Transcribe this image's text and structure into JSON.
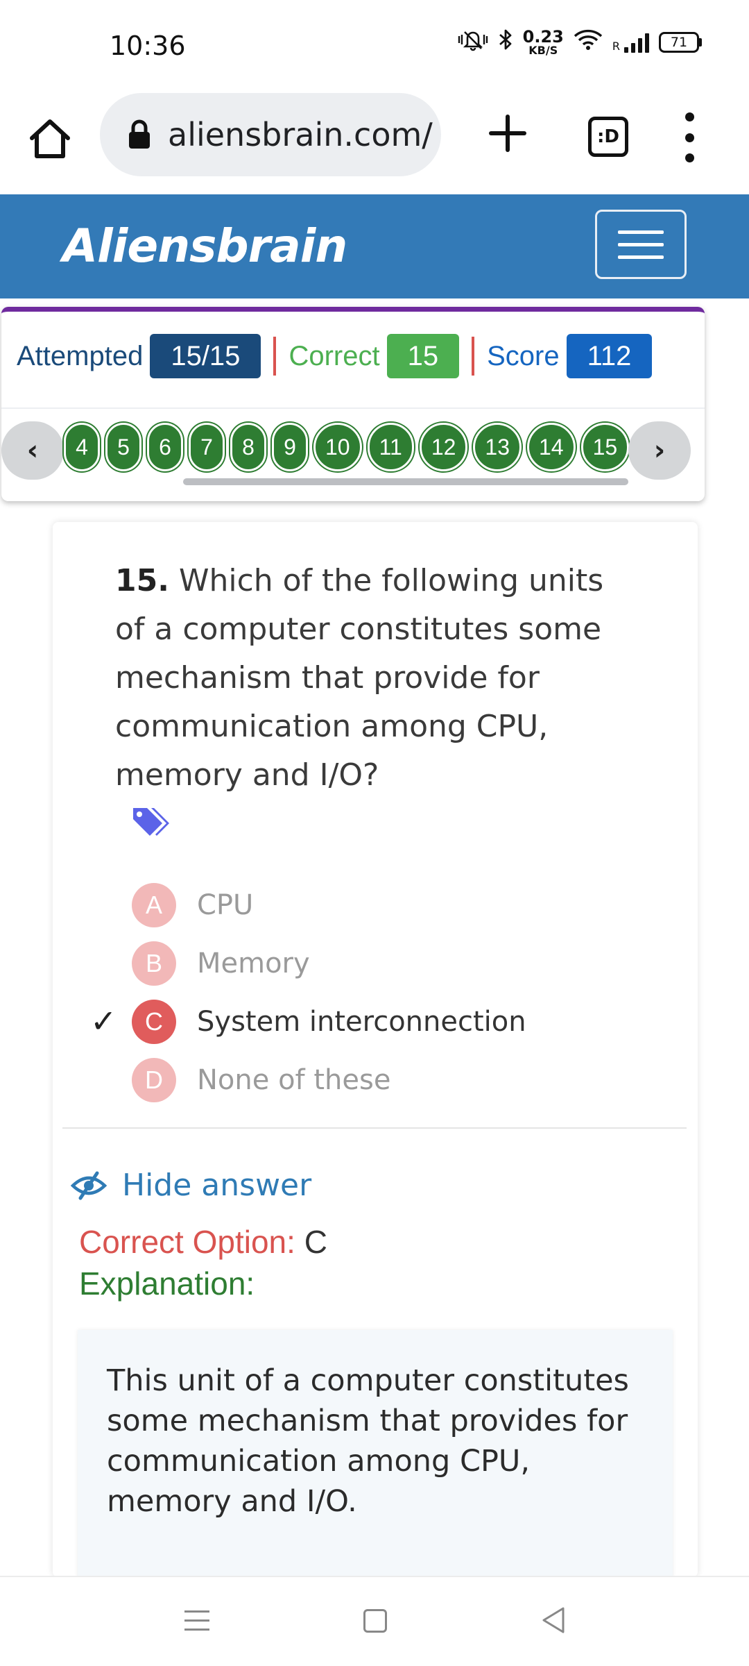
{
  "status_bar": {
    "time": "10:36",
    "speed_value": "0.23",
    "speed_unit": "KB/S",
    "signal_label": "R",
    "battery": "71"
  },
  "browser": {
    "url": "aliensbrain.com/",
    "tabs_label": ":D"
  },
  "navbar": {
    "brand": "Aliensbrain"
  },
  "stats": {
    "attempted_label": "Attempted",
    "attempted_value": "15/15",
    "correct_label": "Correct",
    "correct_value": "15",
    "score_label": "Score",
    "score_value": "112",
    "prev_label": "‹",
    "next_label": "›",
    "question_numbers": [
      "4",
      "5",
      "6",
      "7",
      "8",
      "9",
      "10",
      "11",
      "12",
      "13",
      "14",
      "15"
    ]
  },
  "question": {
    "number": "15.",
    "text": "Which of the following units of a computer constitutes some mechanism that provide for communication among CPU, memory and I/O?",
    "options": [
      {
        "letter": "A",
        "text": "CPU"
      },
      {
        "letter": "B",
        "text": "Memory"
      },
      {
        "letter": "C",
        "text": "System interconnection"
      },
      {
        "letter": "D",
        "text": "None of these"
      }
    ],
    "selected_check": "✓"
  },
  "answer": {
    "hide_label": "Hide answer",
    "correct_option_label": "Correct Option:",
    "correct_option_value": "C",
    "explanation_label": "Explanation:",
    "explanation_text": "This unit of a computer constitutes some mechanism that provides for communication among CPU, memory and I/O."
  },
  "colors": {
    "navbar": "#337ab7",
    "attempted_badge": "#1a4a7a",
    "correct_badge": "#4caf50",
    "score_badge": "#1565c0",
    "correct_option": "#d9534f",
    "explanation": "#2e7d32"
  }
}
